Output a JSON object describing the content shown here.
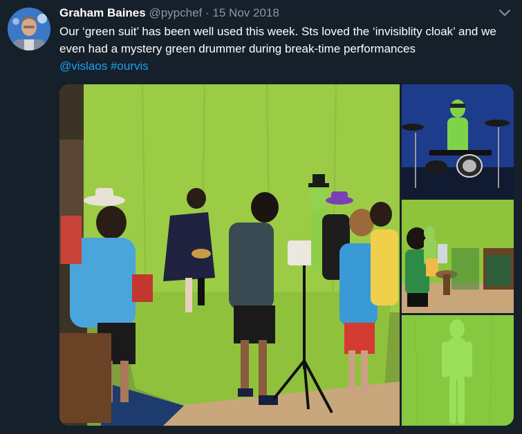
{
  "tweet": {
    "author_name": "Graham Baines",
    "author_handle": "@pypchef",
    "separator": "·",
    "date": "15 Nov 2018",
    "text_part1": "Our ‘green suit’ has been well used this week. Sts loved the ‘invisiblity cloak’ and we even had a mystery green drummer during break-time performances",
    "mention": "@vislaos",
    "hashtag": "#ourvis"
  },
  "icons": {
    "menu": "chevron-down-icon"
  },
  "colors": {
    "background": "#15202b",
    "text": "#ffffff",
    "secondary": "#8899a6",
    "link": "#1da1f2",
    "green_screen": "#8bc34a"
  }
}
